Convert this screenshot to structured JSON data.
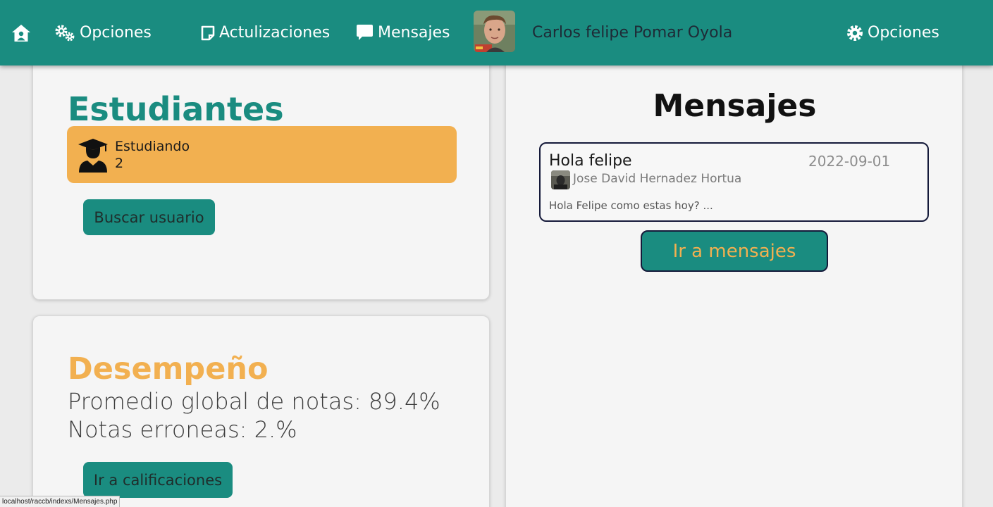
{
  "navbar": {
    "home_icon": "home-icon",
    "opciones_left": "Opciones",
    "actualizaciones": "Actulizaciones",
    "mensajes": "Mensajes",
    "user_name": "Carlos felipe Pomar Oyola",
    "opciones_right": "Opciones"
  },
  "students": {
    "title": "Estudiantes",
    "stat_label": "Estudiando",
    "stat_count": "2",
    "search_button": "Buscar usuario"
  },
  "performance": {
    "title": "Desempeño",
    "average": "Promedio global de notas: 89.4%",
    "errors": "Notas erroneas: 2.%",
    "grades_button": "Ir a calificaciones"
  },
  "messages": {
    "title": "Mensajes",
    "items": [
      {
        "subject": "Hola felipe",
        "date": "2022-09-01",
        "sender": "Jose David Hernadez Hortua",
        "preview": "Hola Felipe como estas hoy? ..."
      }
    ],
    "go_button": "Ir a mensajes"
  },
  "status_bar": "localhost/raccb/indexs/Mensajes.php",
  "colors": {
    "primary": "#1a8c80",
    "accent": "#f2b050",
    "background": "#ebebeb",
    "card": "#f5f5f5"
  }
}
